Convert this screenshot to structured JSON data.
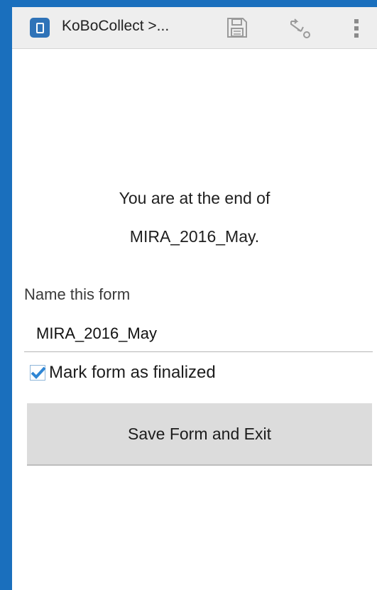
{
  "action_bar": {
    "app_title": "KoBoCollect >...",
    "icons": [
      "app-icon",
      "save-icon",
      "hierarchy-icon",
      "overflow-menu-icon"
    ]
  },
  "end_message": {
    "line1": "You are at the end of",
    "line2": "MIRA_2016_May."
  },
  "form_name": {
    "label": "Name this form",
    "value": "MIRA_2016_May"
  },
  "finalize": {
    "label": "Mark form as finalized",
    "checked": true
  },
  "save_button": {
    "label": "Save Form and Exit"
  },
  "colors": {
    "frame": "#1a6fbd",
    "action_bar": "#eeeeee",
    "accent": "#2f73b8",
    "button": "#dcdcdc"
  }
}
